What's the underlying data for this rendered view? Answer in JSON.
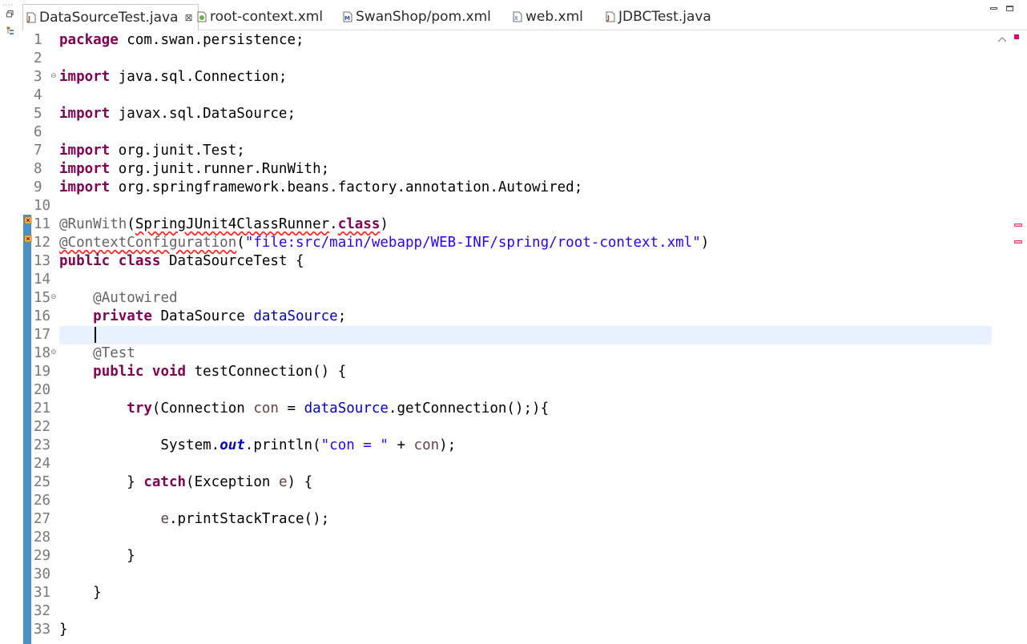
{
  "tabs": [
    {
      "label": "DataSourceTest.java",
      "icon": "java-file-icon",
      "active": true,
      "close": "⊠"
    },
    {
      "label": "root-context.xml",
      "icon": "spring-xml-icon",
      "active": false
    },
    {
      "label": "SwanShop/pom.xml",
      "icon": "maven-pom-icon",
      "active": false
    },
    {
      "label": "web.xml",
      "icon": "xml-file-icon",
      "active": false
    },
    {
      "label": "JDBCTest.java",
      "icon": "java-file-icon",
      "active": false
    }
  ],
  "editor": {
    "current_line": 17,
    "lines": [
      {
        "n": "1",
        "text": "package com.swan.persistence;"
      },
      {
        "n": "2",
        "text": ""
      },
      {
        "n": "3",
        "text": "import java.sql.Connection;"
      },
      {
        "n": "4",
        "text": ""
      },
      {
        "n": "5",
        "text": "import javax.sql.DataSource;"
      },
      {
        "n": "6",
        "text": ""
      },
      {
        "n": "7",
        "text": "import org.junit.Test;"
      },
      {
        "n": "8",
        "text": "import org.junit.runner.RunWith;"
      },
      {
        "n": "9",
        "text": "import org.springframework.beans.factory.annotation.Autowired;"
      },
      {
        "n": "10",
        "text": ""
      },
      {
        "n": "11",
        "text": "@RunWith(SpringJUnit4ClassRunner.class)"
      },
      {
        "n": "12",
        "text": "@ContextConfiguration(\"file:src/main/webapp/WEB-INF/spring/root-context.xml\")"
      },
      {
        "n": "13",
        "text": "public class DataSourceTest {"
      },
      {
        "n": "14",
        "text": ""
      },
      {
        "n": "15",
        "text": "    @Autowired"
      },
      {
        "n": "16",
        "text": "    private DataSource dataSource;"
      },
      {
        "n": "17",
        "text": ""
      },
      {
        "n": "18",
        "text": "    @Test"
      },
      {
        "n": "19",
        "text": "    public void testConnection() {"
      },
      {
        "n": "20",
        "text": ""
      },
      {
        "n": "21",
        "text": "        try(Connection con = dataSource.getConnection();){"
      },
      {
        "n": "22",
        "text": ""
      },
      {
        "n": "23",
        "text": "            System.out.println(\"con = \" + con);"
      },
      {
        "n": "24",
        "text": ""
      },
      {
        "n": "25",
        "text": "        } catch(Exception e) {"
      },
      {
        "n": "26",
        "text": ""
      },
      {
        "n": "27",
        "text": "            e.printStackTrace();"
      },
      {
        "n": "28",
        "text": ""
      },
      {
        "n": "29",
        "text": "        }"
      },
      {
        "n": "30",
        "text": ""
      },
      {
        "n": "31",
        "text": "    }"
      },
      {
        "n": "32",
        "text": ""
      },
      {
        "n": "33",
        "text": "}"
      }
    ],
    "fold_lines": [
      "3",
      "15",
      "18"
    ],
    "error_lines": [
      "11",
      "12"
    ]
  },
  "colors": {
    "keyword": "#7f0055",
    "annotation": "#646464",
    "string": "#2a00ff",
    "field": "#0000c0",
    "local_variable": "#6a3e3e",
    "current_line": "#e8f2fe",
    "quick_diff": "#4a90c8"
  }
}
